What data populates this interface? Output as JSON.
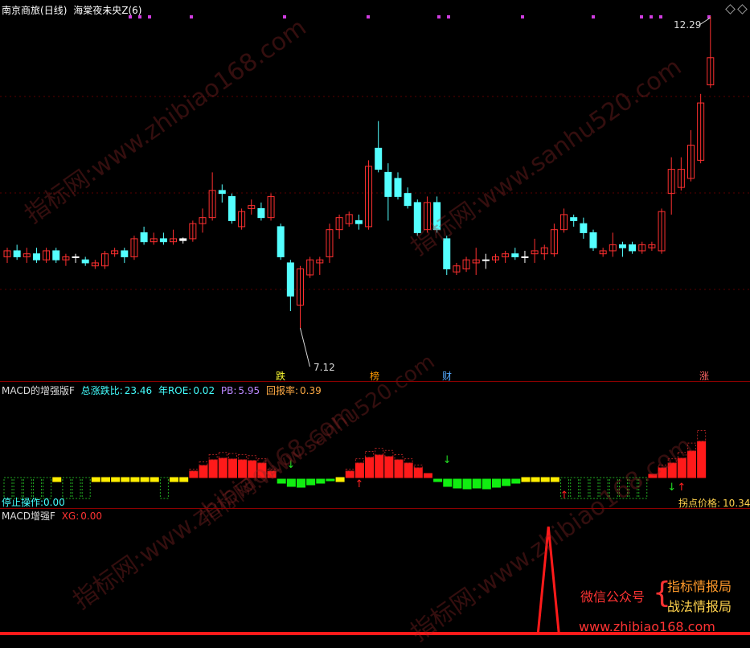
{
  "panel1": {
    "stock_name": "南京商旅",
    "period": "(日线)",
    "indicator": "海棠夜未央Z(6)",
    "high_label": "12.29",
    "low_label": "7.12",
    "markers": [
      "跌",
      "榜",
      "财",
      "涨"
    ],
    "colors": {
      "up": "#ff3030",
      "down": "#54ffff",
      "doji": "#ffffff"
    }
  },
  "panel2": {
    "title": "MACD的增强版F",
    "stat1_label": "总涨跌比:",
    "stat1_value": "23.46",
    "stat2_label": "年ROE:",
    "stat2_value": "0.02",
    "stat3_label": "PB:",
    "stat3_value": "5.95",
    "stat4_label": "回报率:",
    "stat4_value": "0.39",
    "op_label": "停止操作:",
    "op_value": "0.00",
    "pivot_label": "拐点价格:",
    "pivot_value": "10.34"
  },
  "panel3": {
    "title": "MACD增强F",
    "xg_label": "XG:",
    "xg_value": "0.00",
    "promo_line1": "微信公众号",
    "promo_line2a": "指标情报局",
    "promo_line2b": "战法情报局",
    "promo_url": "www.zhibiao168.com"
  },
  "watermarks": [
    "指标网:www.zhibiao168.com",
    "指标网:www.sanhu520.com"
  ],
  "chart_data": {
    "type": "candlestick",
    "price_range": [
      7.12,
      12.29
    ],
    "candles": [
      [
        8.3,
        8.4,
        8.2,
        8.45
      ],
      [
        8.4,
        8.3,
        8.25,
        8.5
      ],
      [
        8.3,
        8.35,
        8.2,
        8.45
      ],
      [
        8.35,
        8.25,
        8.2,
        8.45
      ],
      [
        8.25,
        8.4,
        8.2,
        8.45
      ],
      [
        8.4,
        8.25,
        8.2,
        8.45
      ],
      [
        8.25,
        8.3,
        8.15,
        8.35
      ],
      [
        8.3,
        8.3,
        8.2,
        8.35
      ],
      [
        8.25,
        8.2,
        8.15,
        8.3
      ],
      [
        8.15,
        8.2,
        8.1,
        8.25
      ],
      [
        8.15,
        8.35,
        8.1,
        8.4
      ],
      [
        8.35,
        8.4,
        8.3,
        8.45
      ],
      [
        8.4,
        8.3,
        8.2,
        8.45
      ],
      [
        8.3,
        8.6,
        8.25,
        8.65
      ],
      [
        8.7,
        8.55,
        8.5,
        8.8
      ],
      [
        8.55,
        8.6,
        8.5,
        8.7
      ],
      [
        8.6,
        8.55,
        8.5,
        8.7
      ],
      [
        8.55,
        8.6,
        8.5,
        8.75
      ],
      [
        8.6,
        8.57,
        8.52,
        8.62
      ],
      [
        8.6,
        8.85,
        8.55,
        8.9
      ],
      [
        8.85,
        8.95,
        8.7,
        9.1
      ],
      [
        8.95,
        9.4,
        8.9,
        9.7
      ],
      [
        9.4,
        9.35,
        9.2,
        9.5
      ],
      [
        9.3,
        8.9,
        8.85,
        9.35
      ],
      [
        8.8,
        9.05,
        8.75,
        9.1
      ],
      [
        9.1,
        9.15,
        9.0,
        9.25
      ],
      [
        9.1,
        8.95,
        8.9,
        9.2
      ],
      [
        8.95,
        9.3,
        8.9,
        9.35
      ],
      [
        8.8,
        8.3,
        8.25,
        8.85
      ],
      [
        8.2,
        7.65,
        7.4,
        8.25
      ],
      [
        7.5,
        8.1,
        7.12,
        8.15
      ],
      [
        8.0,
        8.25,
        7.95,
        8.3
      ],
      [
        8.2,
        8.25,
        8.0,
        8.3
      ],
      [
        8.3,
        8.75,
        8.2,
        8.85
      ],
      [
        8.75,
        8.95,
        8.6,
        9.0
      ],
      [
        8.85,
        9.0,
        8.8,
        9.05
      ],
      [
        8.9,
        8.85,
        8.75,
        9.0
      ],
      [
        8.8,
        9.8,
        8.75,
        9.9
      ],
      [
        10.1,
        9.75,
        9.7,
        10.55
      ],
      [
        9.7,
        9.3,
        8.9,
        9.85
      ],
      [
        9.6,
        9.3,
        9.25,
        9.7
      ],
      [
        9.35,
        9.15,
        9.1,
        9.45
      ],
      [
        9.2,
        8.7,
        8.65,
        9.25
      ],
      [
        8.75,
        9.2,
        8.7,
        9.3
      ],
      [
        9.2,
        8.75,
        8.7,
        9.3
      ],
      [
        8.6,
        8.1,
        8.0,
        8.65
      ],
      [
        8.05,
        8.15,
        8.0,
        8.2
      ],
      [
        8.1,
        8.25,
        8.05,
        8.3
      ],
      [
        8.2,
        8.25,
        8.0,
        8.45
      ],
      [
        8.25,
        8.25,
        8.1,
        8.35
      ],
      [
        8.25,
        8.3,
        8.2,
        8.35
      ],
      [
        8.3,
        8.35,
        8.2,
        8.4
      ],
      [
        8.35,
        8.3,
        8.25,
        8.45
      ],
      [
        8.3,
        8.3,
        8.2,
        8.4
      ],
      [
        8.35,
        8.4,
        8.2,
        8.6
      ],
      [
        8.35,
        8.45,
        8.25,
        8.5
      ],
      [
        8.35,
        8.75,
        8.3,
        8.85
      ],
      [
        8.75,
        9.0,
        8.7,
        9.1
      ],
      [
        8.95,
        8.9,
        8.8,
        9.0
      ],
      [
        8.85,
        8.7,
        8.6,
        8.95
      ],
      [
        8.7,
        8.45,
        8.4,
        8.75
      ],
      [
        8.35,
        8.4,
        8.3,
        8.45
      ],
      [
        8.4,
        8.5,
        8.3,
        8.7
      ],
      [
        8.5,
        8.45,
        8.3,
        8.55
      ],
      [
        8.5,
        8.4,
        8.35,
        8.55
      ],
      [
        8.4,
        8.5,
        8.35,
        8.55
      ],
      [
        8.45,
        8.5,
        8.4,
        8.55
      ],
      [
        8.4,
        9.05,
        8.35,
        9.1
      ],
      [
        9.35,
        9.75,
        9.0,
        9.95
      ],
      [
        9.45,
        9.75,
        9.4,
        9.95
      ],
      [
        9.6,
        10.15,
        9.55,
        10.4
      ],
      [
        9.9,
        10.85,
        9.85,
        11.0
      ],
      [
        11.15,
        11.6,
        11.1,
        12.29
      ]
    ],
    "macd_bars": [
      [
        0.01,
        "g"
      ],
      [
        0.01,
        "g"
      ],
      [
        0.01,
        "g"
      ],
      [
        0.01,
        "g"
      ],
      [
        0.01,
        "g"
      ],
      [
        0.01,
        "y"
      ],
      [
        0.01,
        "g"
      ],
      [
        0.01,
        "g"
      ],
      [
        0.01,
        "g"
      ],
      [
        0.01,
        "y"
      ],
      [
        0.01,
        "y"
      ],
      [
        0.01,
        "y"
      ],
      [
        0.01,
        "y"
      ],
      [
        0.01,
        "y"
      ],
      [
        0.01,
        "y"
      ],
      [
        0.01,
        "y"
      ],
      [
        0.01,
        "g"
      ],
      [
        0.01,
        "y"
      ],
      [
        0.01,
        "y"
      ],
      [
        0.08,
        "r"
      ],
      [
        0.15,
        "r"
      ],
      [
        0.22,
        "r"
      ],
      [
        0.24,
        "r"
      ],
      [
        0.23,
        "r"
      ],
      [
        0.22,
        "r"
      ],
      [
        0.21,
        "r"
      ],
      [
        0.18,
        "r"
      ],
      [
        0.08,
        "r"
      ],
      [
        -0.05,
        "G"
      ],
      [
        -0.09,
        "G"
      ],
      [
        -0.1,
        "G"
      ],
      [
        -0.07,
        "G"
      ],
      [
        -0.05,
        "G"
      ],
      [
        -0.02,
        "G"
      ],
      [
        0.01,
        "y"
      ],
      [
        0.08,
        "r"
      ],
      [
        0.18,
        "r"
      ],
      [
        0.25,
        "r"
      ],
      [
        0.28,
        "r"
      ],
      [
        0.26,
        "r"
      ],
      [
        0.22,
        "r"
      ],
      [
        0.18,
        "r"
      ],
      [
        0.12,
        "r"
      ],
      [
        0.05,
        "r"
      ],
      [
        -0.03,
        "G"
      ],
      [
        -0.09,
        "G"
      ],
      [
        -0.11,
        "G"
      ],
      [
        -0.12,
        "G"
      ],
      [
        -0.11,
        "G"
      ],
      [
        -0.12,
        "G"
      ],
      [
        -0.1,
        "G"
      ],
      [
        -0.08,
        "G"
      ],
      [
        -0.05,
        "G"
      ],
      [
        0.01,
        "y"
      ],
      [
        0.01,
        "y"
      ],
      [
        0.01,
        "y"
      ],
      [
        0.01,
        "y"
      ],
      [
        0.01,
        "g"
      ],
      [
        0.01,
        "g"
      ],
      [
        0.01,
        "g"
      ],
      [
        0.01,
        "g"
      ],
      [
        0.01,
        "g"
      ],
      [
        0.01,
        "g"
      ],
      [
        0.01,
        "g"
      ],
      [
        0.01,
        "g"
      ],
      [
        0.01,
        "g"
      ],
      [
        0.04,
        "r"
      ],
      [
        0.12,
        "r"
      ],
      [
        0.18,
        "r"
      ],
      [
        0.24,
        "r"
      ],
      [
        0.33,
        "r"
      ],
      [
        0.45,
        "r"
      ]
    ],
    "xg_signal": [
      0,
      0,
      0,
      0,
      0,
      0,
      0,
      0,
      0,
      0,
      0,
      0,
      0,
      0,
      0,
      0,
      0,
      0,
      0,
      0,
      0,
      0,
      0,
      0,
      0,
      0,
      0,
      0,
      0,
      0,
      0,
      0,
      0,
      0,
      0,
      0,
      0,
      0,
      0,
      0,
      0,
      0,
      0,
      0,
      0,
      0,
      0,
      0,
      0,
      0,
      0,
      0,
      0,
      0,
      0,
      1,
      0,
      0,
      0,
      0,
      0,
      0,
      0,
      0,
      0,
      0,
      0,
      0,
      0,
      0,
      0,
      0
    ]
  }
}
